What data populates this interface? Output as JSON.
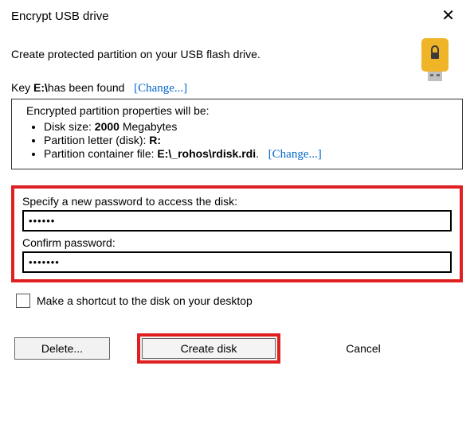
{
  "window": {
    "title": "Encrypt USB drive"
  },
  "description": "Create protected partition on your USB flash drive.",
  "key_line": {
    "prefix": "Key ",
    "path": "E:\\",
    "suffix": "has been found",
    "change": "[Change...]"
  },
  "properties": {
    "heading": "Encrypted partition properties will be:",
    "size_label": "Disk size: ",
    "size_value": "2000",
    "size_unit": " Megabytes",
    "letter_label": "Partition letter (disk): ",
    "letter_value": "R:",
    "container_label": "Partition container file: ",
    "container_value": "E:\\_rohos\\rdisk.rdi",
    "container_dot": ".",
    "change": "[Change...]"
  },
  "password": {
    "label": "Specify a new password to access the disk:",
    "value": "••••••",
    "confirm_label": "Confirm password:",
    "confirm_value": "•••••••"
  },
  "shortcut": {
    "label": "Make a shortcut to the disk on your desktop",
    "checked": false
  },
  "buttons": {
    "delete": "Delete...",
    "create": "Create disk",
    "cancel": "Cancel"
  }
}
